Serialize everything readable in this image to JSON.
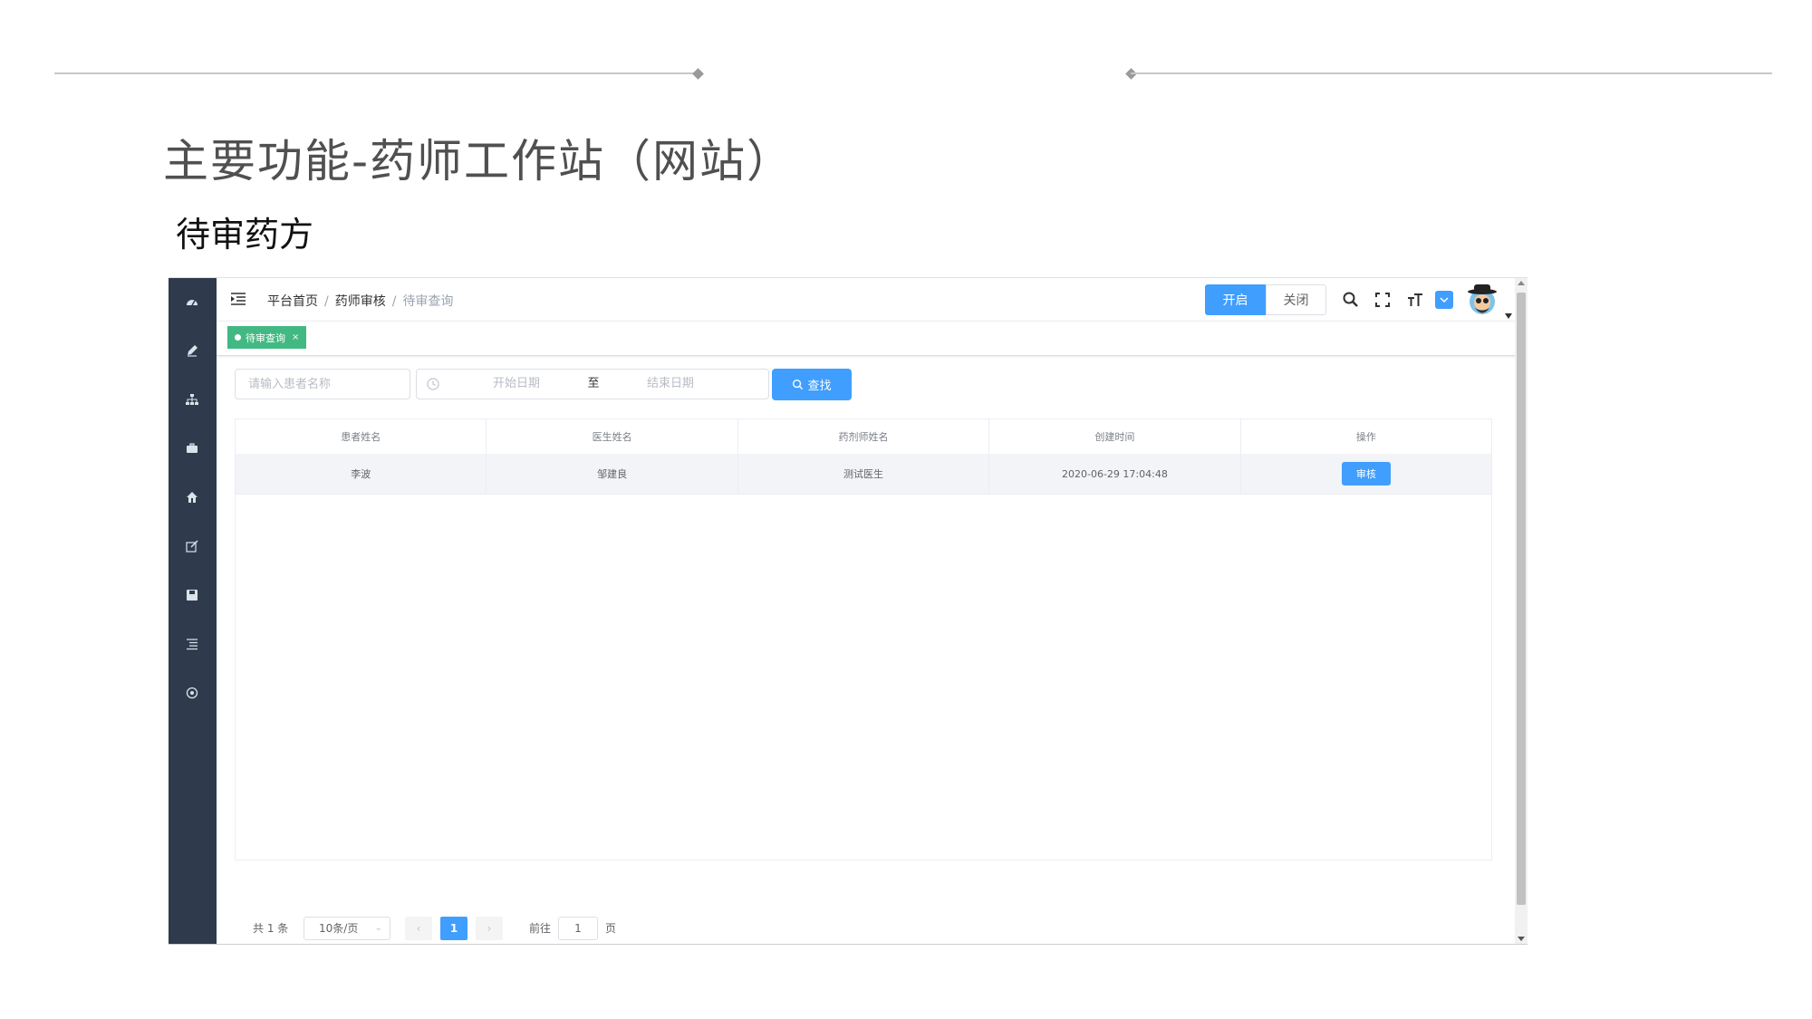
{
  "slide": {
    "title": "主要功能-药师工作站（网站）",
    "subtitle": "待审药方"
  },
  "sidebar": {
    "items": [
      {
        "icon": "dashboard-icon"
      },
      {
        "icon": "pen-icon"
      },
      {
        "icon": "sitemap-icon"
      },
      {
        "icon": "briefcase-icon"
      },
      {
        "icon": "home-icon"
      },
      {
        "icon": "edit-icon"
      },
      {
        "icon": "save-icon"
      },
      {
        "icon": "list-icon"
      },
      {
        "icon": "settings-icon"
      }
    ]
  },
  "header": {
    "breadcrumb": [
      "平台首页",
      "药师审核",
      "待审查询"
    ],
    "open_label": "开启",
    "close_label": "关闭",
    "icons": [
      "search-icon",
      "fullscreen-icon",
      "font-size-icon",
      "message-icon",
      "avatar",
      "chevron-down-icon"
    ]
  },
  "tags": [
    {
      "label": "待审查询",
      "close": "×"
    }
  ],
  "search": {
    "name_placeholder": "请输入患者名称",
    "start_placeholder": "开始日期",
    "range_separator": "至",
    "end_placeholder": "结束日期",
    "search_label": "查找"
  },
  "table": {
    "columns": [
      "患者姓名",
      "医生姓名",
      "药剂师姓名",
      "创建时间",
      "操作"
    ],
    "rows": [
      {
        "patient": "李波",
        "doctor": "邹建良",
        "pharmacist": "测试医生",
        "created": "2020-06-29 17:04:48",
        "action": "审核"
      }
    ]
  },
  "pagination": {
    "total": "共 1 条",
    "page_size": "10条/页",
    "prev": "‹",
    "current_page": "1",
    "next": "›",
    "goto_label": "前往",
    "goto_value": "1",
    "page_label": "页"
  },
  "colors": {
    "primary": "#409eff",
    "sidebar": "#2f3b4d",
    "tag": "#42b983"
  }
}
